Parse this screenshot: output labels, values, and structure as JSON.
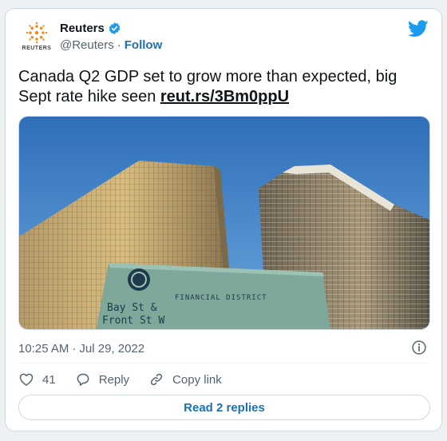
{
  "author": {
    "display_name": "Reuters",
    "handle": "@Reuters",
    "separator": "·",
    "follow_label": "Follow",
    "avatar_word": "REUTERS"
  },
  "tweet": {
    "text_before_link": "Canada Q2 GDP set to grow more than expected, big Sept rate hike seen ",
    "link_text": "reut.rs/3Bm0ppU",
    "time": "10:25 AM",
    "separator": "·",
    "date": "Jul 29, 2022"
  },
  "media": {
    "sign_line1": "FINANCIAL DISTRICT",
    "sign_line2": "Bay St &",
    "sign_line3": "Front St W"
  },
  "actions": {
    "like_count": "41",
    "reply_label": "Reply",
    "copy_link_label": "Copy link"
  },
  "footer": {
    "read_replies_label": "Read 2 replies"
  },
  "colors": {
    "link_blue": "#1d6fb8",
    "twitter_blue": "#1d9bf0",
    "text_gray": "#536471"
  },
  "icons": [
    "reuters-logo-icon",
    "verified-badge-icon",
    "twitter-bird-icon",
    "info-icon",
    "heart-icon",
    "reply-bubble-icon",
    "copy-link-icon"
  ]
}
